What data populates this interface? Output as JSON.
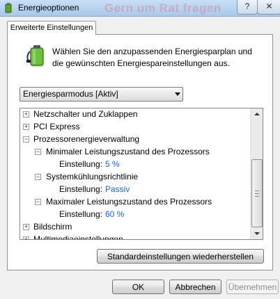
{
  "window": {
    "title": "Energieoptionen",
    "ghost_text": "Gern um Rat fragen",
    "help_label": "?",
    "close_label": "✕"
  },
  "tab": {
    "label": "Erweiterte Einstellungen"
  },
  "intro": {
    "text": "Wählen Sie den anzupassenden Energiesparplan und die gewünschten Energiespareinstellungen aus."
  },
  "plan_select": {
    "value": "Energiesparmodus [Aktiv]"
  },
  "tree": {
    "items": [
      {
        "label": "Netzschalter und Zuklappen",
        "expander": "+"
      },
      {
        "label": "PCI Express",
        "expander": "+"
      },
      {
        "label": "Prozessorenergieverwaltung",
        "expander": "−"
      },
      {
        "label": "Minimaler Leistungszustand des Prozessors",
        "expander": "−"
      },
      {
        "label": "Einstellung:",
        "value": "5 %"
      },
      {
        "label": "Systemkühlungsrichtlinie",
        "expander": "−"
      },
      {
        "label": "Einstellung:",
        "value": "Passiv"
      },
      {
        "label": "Maximaler Leistungszustand des Prozessors",
        "expander": "−"
      },
      {
        "label": "Einstellung:",
        "value": "60 %"
      },
      {
        "label": "Bildschirm",
        "expander": "+"
      },
      {
        "label": "Multimediaeinstellungen",
        "expander": "+"
      }
    ]
  },
  "buttons": {
    "restore": "Standardeinstellungen wiederherstellen",
    "ok": "OK",
    "cancel": "Abbrechen",
    "apply": "Übernehmen"
  },
  "colors": {
    "value_text": "#1f63c4",
    "titlebar": "#b9d3f0"
  }
}
